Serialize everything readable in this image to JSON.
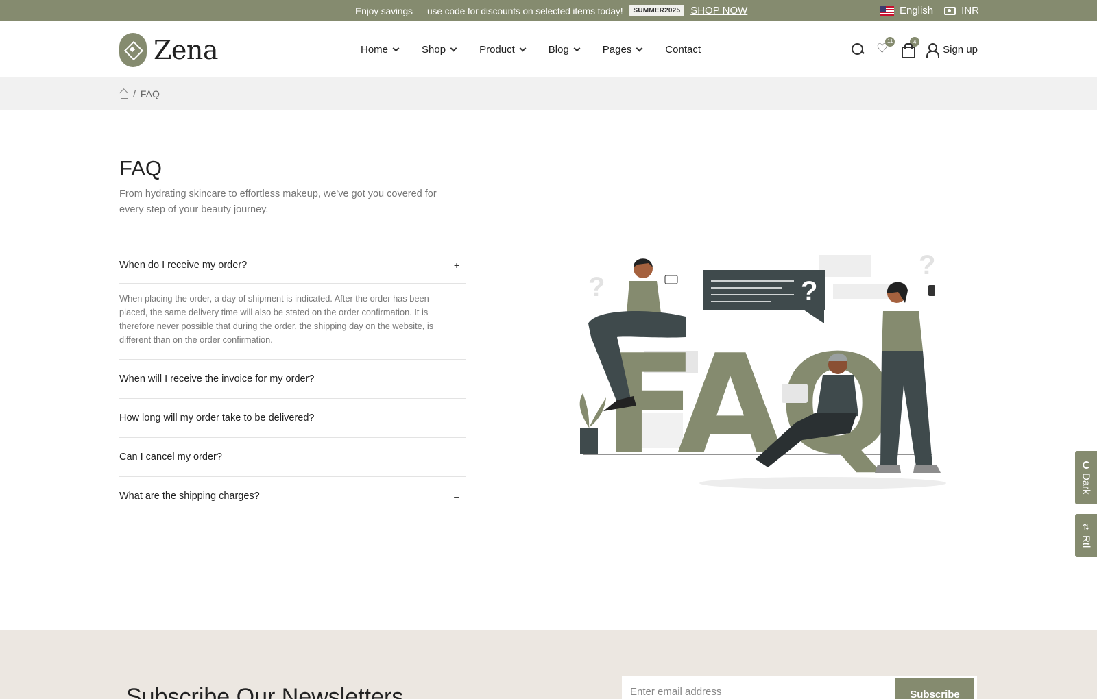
{
  "topbar": {
    "promo_text": "Enjoy savings — use code for discounts on selected items today!",
    "promo_code": "SUMMER2025",
    "shop_now": "SHOP NOW",
    "language": "English",
    "currency": "INR"
  },
  "header": {
    "brand": "Zena",
    "nav": [
      {
        "label": "Home",
        "has_dropdown": true
      },
      {
        "label": "Shop",
        "has_dropdown": true
      },
      {
        "label": "Product",
        "has_dropdown": true
      },
      {
        "label": "Blog",
        "has_dropdown": true
      },
      {
        "label": "Pages",
        "has_dropdown": true
      },
      {
        "label": "Contact",
        "has_dropdown": false
      }
    ],
    "wishlist_count": "11",
    "cart_count": "4",
    "signup_label": "Sign up"
  },
  "breadcrumb": {
    "separator": "/",
    "current": "FAQ"
  },
  "faq": {
    "title": "FAQ",
    "subtitle": "From hydrating skincare to effortless makeup, we've got you covered for every step of your beauty journey.",
    "items": [
      {
        "question": "When do I receive my order?",
        "toggle": "+",
        "answer": "When placing the order, a day of shipment is indicated. After the order has been placed, the same delivery time will also be stated on the order confirmation. It is therefore never possible that during the order, the shipping day on the website, is different than on the order confirmation."
      },
      {
        "question": "When will I receive the invoice for my order?",
        "toggle": "–"
      },
      {
        "question": "How long will my order take to be delivered?",
        "toggle": "–"
      },
      {
        "question": "Can I cancel my order?",
        "toggle": "–"
      },
      {
        "question": "What are the shipping charges?",
        "toggle": "–"
      }
    ]
  },
  "illustration": {
    "letters": "FAQ",
    "bubble_mark": "?",
    "question_mark": "?"
  },
  "side_tabs": {
    "dark": "Dark",
    "rtl": "Rtl"
  },
  "newsletter": {
    "title": "Subscribe Our Newsletters",
    "placeholder": "Enter email address",
    "button": "Subscribe"
  },
  "colors": {
    "accent": "#858b6f",
    "slate": "#3f4a4c",
    "breadcrumb_bg": "#f1f1f1",
    "newsletter_bg": "#ece7e1"
  }
}
